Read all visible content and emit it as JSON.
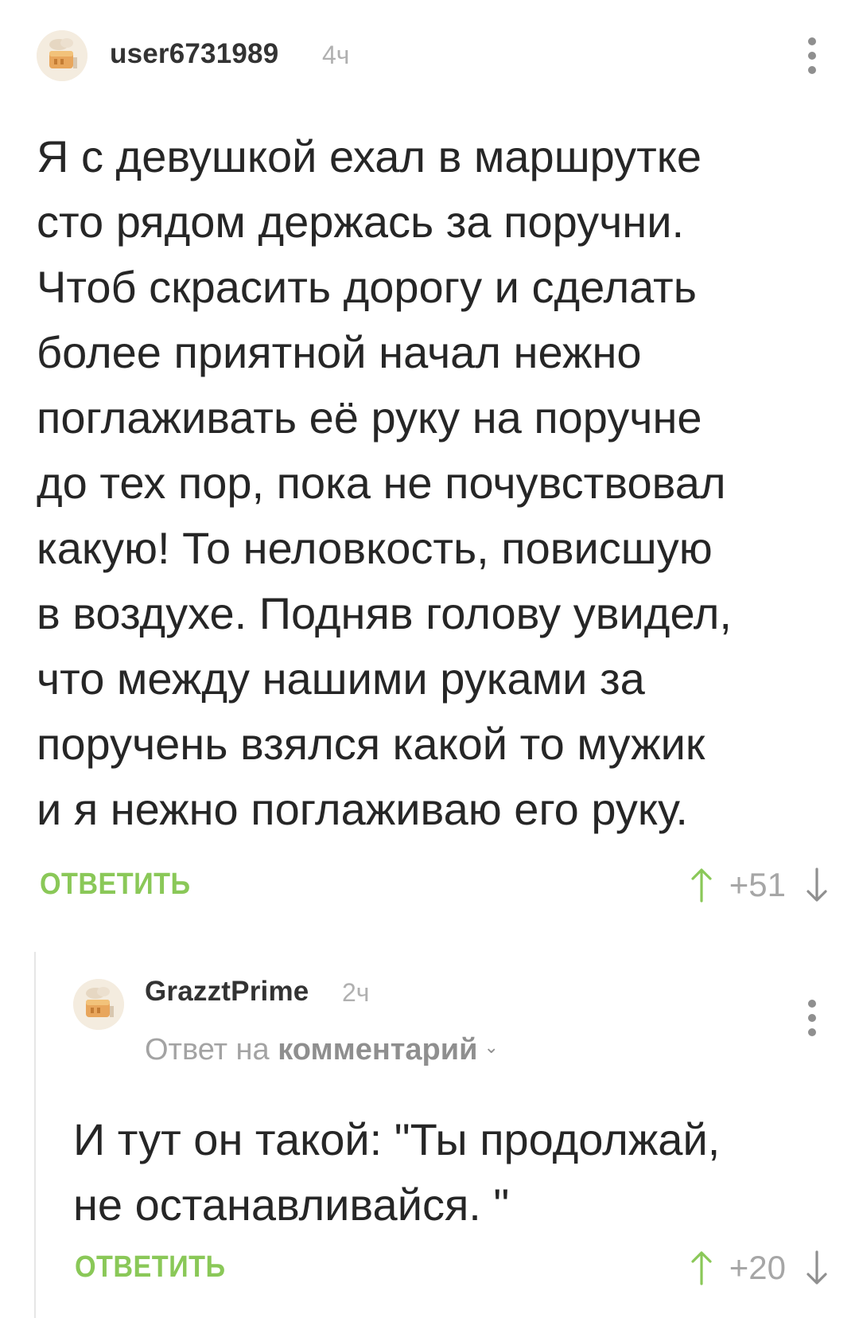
{
  "comments": [
    {
      "username": "user6731989",
      "time": "4ч",
      "lines": [
        "Я с девушкой ехал в маршрутке",
        "сто рядом держась за поручни.",
        "Чтоб скрасить дорогу и сделать",
        "более приятной начал нежно",
        "поглаживать её руку на поручне",
        "до тех пор, пока не почувствовал",
        "какую! То неловкость, повисшую",
        "в воздухе. Подняв голову увидел,",
        "что между нашими руками за",
        "поручень взялся какой то мужик",
        "и я нежно поглаживаю его руку."
      ],
      "reply_label": "ОТВЕТИТЬ",
      "rating": "+51"
    },
    {
      "username": "GrazztPrime",
      "time": "2ч",
      "reply_prefix": "Ответ на",
      "reply_target": "комментарий",
      "lines": [
        "И тут он такой: \"Ты продолжай,",
        "не останавливайся. \""
      ],
      "reply_label": "ОТВЕТИТЬ",
      "rating": "+20"
    }
  ],
  "colors": {
    "accent_green": "#8ac858",
    "text": "#262626",
    "muted": "#a6a6a6"
  },
  "icons": {
    "menu": "more-vertical-icon",
    "upvote": "arrow-up-icon",
    "downvote": "arrow-down-icon",
    "avatar": "default-avatar-cake-icon"
  }
}
